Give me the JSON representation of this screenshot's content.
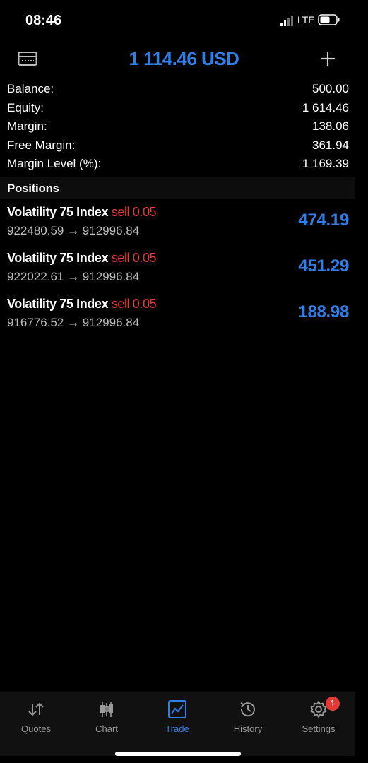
{
  "status_bar": {
    "time": "08:46",
    "network": "LTE"
  },
  "header": {
    "title": "1 114.46 USD"
  },
  "summary": [
    {
      "label": "Balance:",
      "value": "500.00"
    },
    {
      "label": "Equity:",
      "value": "1 614.46"
    },
    {
      "label": "Margin:",
      "value": "138.06"
    },
    {
      "label": "Free Margin:",
      "value": "361.94"
    },
    {
      "label": "Margin Level (%):",
      "value": "1 169.39"
    }
  ],
  "positions": {
    "title": "Positions",
    "items": [
      {
        "symbol": "Volatility 75 Index",
        "side": "sell 0.05",
        "prices": "922480.59 → 912996.84",
        "profit": "474.19"
      },
      {
        "symbol": "Volatility 75 Index",
        "side": "sell 0.05",
        "prices": "922022.61 → 912996.84",
        "profit": "451.29"
      },
      {
        "symbol": "Volatility 75 Index",
        "side": "sell 0.05",
        "prices": "916776.52 → 912996.84",
        "profit": "188.98"
      }
    ]
  },
  "tabs": [
    {
      "label": "Quotes",
      "icon": "quotes-arrows-icon"
    },
    {
      "label": "Chart",
      "icon": "candlestick-icon"
    },
    {
      "label": "Trade",
      "icon": "trade-chart-icon",
      "active": true
    },
    {
      "label": "History",
      "icon": "history-clock-icon"
    },
    {
      "label": "Settings",
      "icon": "gear-icon",
      "badge": "1"
    }
  ],
  "colors": {
    "accent": "#2f7fe8",
    "sell": "#e53935",
    "background": "#000000"
  }
}
